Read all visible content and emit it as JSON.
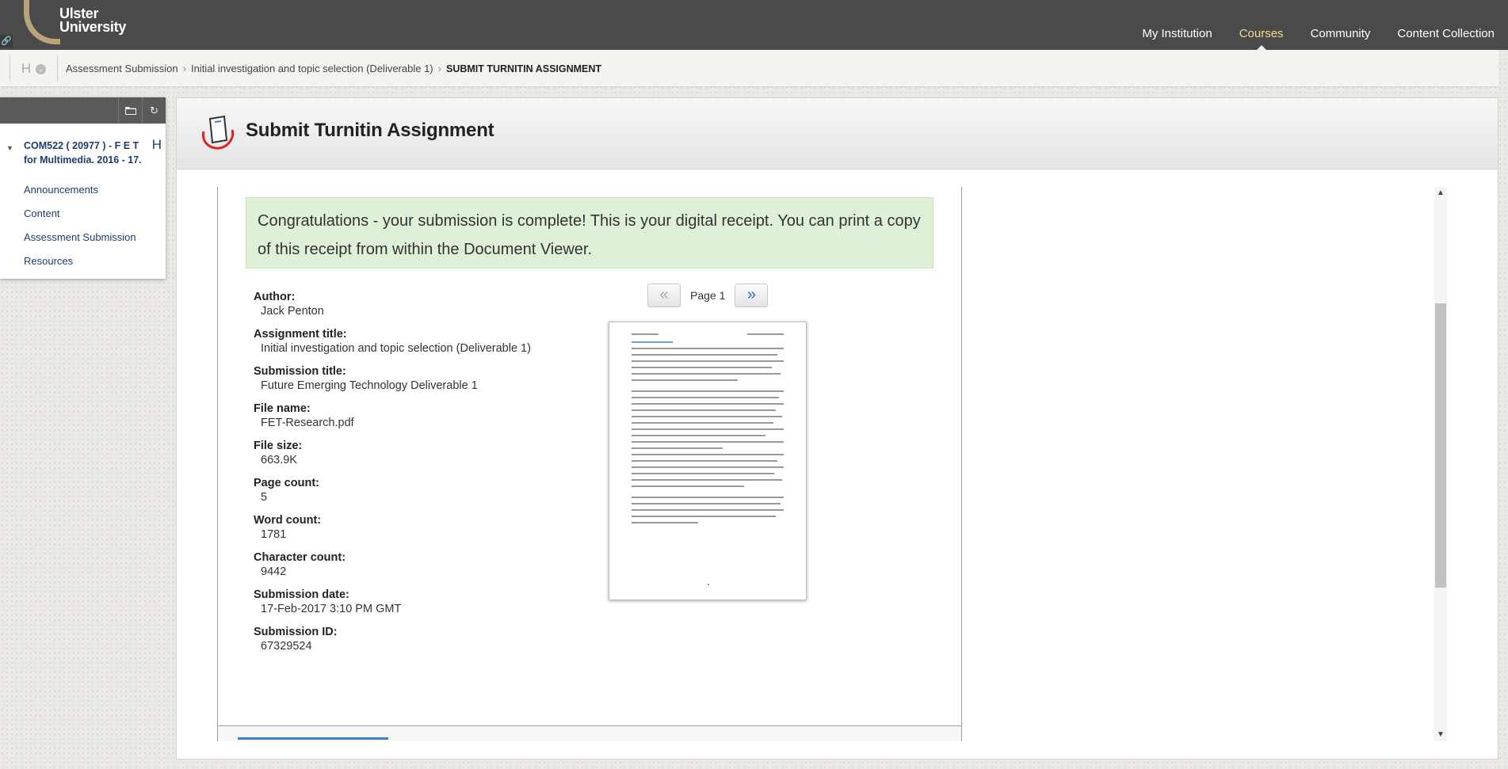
{
  "brand": {
    "line1": "Ulster",
    "line2": "University"
  },
  "nav": [
    {
      "label": "My Institution",
      "active": false
    },
    {
      "label": "Courses",
      "active": true
    },
    {
      "label": "Community",
      "active": false
    },
    {
      "label": "Content Collection",
      "active": false
    }
  ],
  "breadcrumb": {
    "menu_letter": "H",
    "items": [
      "Assessment Submission",
      "Initial investigation and topic selection (Deliverable 1)"
    ],
    "current": "SUBMIT TURNITIN ASSIGNMENT"
  },
  "course_menu": {
    "title": "COM522 ( 20977 ) - F E T for Multimedia. 2016 - 17.",
    "title_letter": "H",
    "links": [
      "Announcements",
      "Content",
      "Assessment Submission",
      "Resources"
    ]
  },
  "page": {
    "title": "Submit Turnitin Assignment",
    "success_message": "Congratulations - your submission is complete! This is your digital receipt. You can print a copy of this receipt from within the Document Viewer."
  },
  "receipt": {
    "fields": [
      {
        "label": "Author:",
        "value": "Jack Penton"
      },
      {
        "label": "Assignment title:",
        "value": "Initial investigation and topic selection (Deliverable 1)"
      },
      {
        "label": "Submission title:",
        "value": "Future Emerging Technology Deliverable 1"
      },
      {
        "label": "File name:",
        "value": "FET-Research.pdf"
      },
      {
        "label": "File size:",
        "value": "663.9K"
      },
      {
        "label": "Page count:",
        "value": "5"
      },
      {
        "label": "Word count:",
        "value": "1781"
      },
      {
        "label": "Character count:",
        "value": "9442"
      },
      {
        "label": "Submission date:",
        "value": "17-Feb-2017 3:10 PM GMT"
      },
      {
        "label": "Submission ID:",
        "value": "67329524"
      }
    ]
  },
  "viewer": {
    "prev_label": "«",
    "next_label": "»",
    "page_label": "Page 1"
  },
  "colors": {
    "topbar": "#4a4a4a",
    "active_nav": "#f3d98f",
    "link": "#1d3d6b",
    "success_bg": "#dff0d8"
  }
}
